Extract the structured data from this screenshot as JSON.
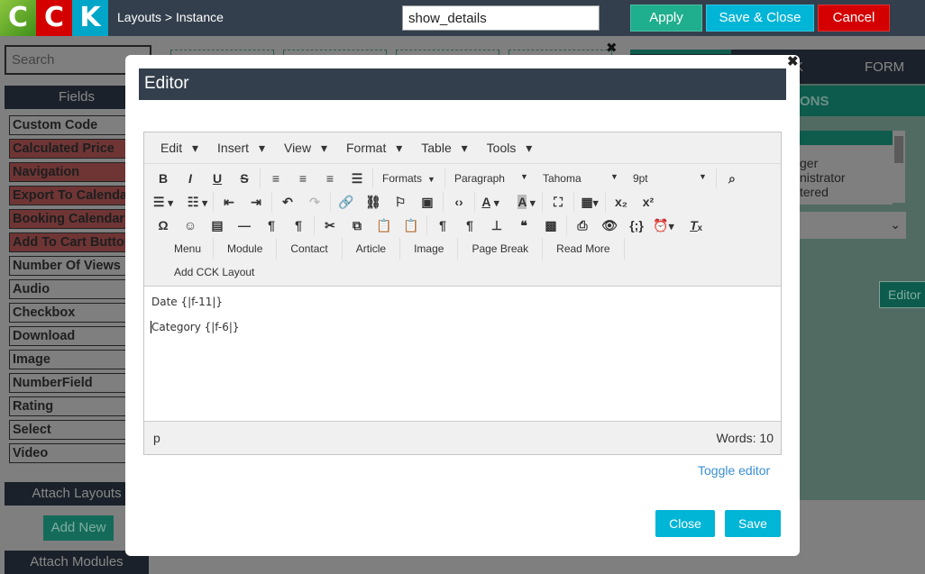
{
  "header": {
    "logo": [
      "C",
      "C",
      "K"
    ],
    "breadcrumb": "Layouts > Instance",
    "name_value": "show_details",
    "apply": "Apply",
    "save_close": "Save & Close",
    "cancel": "Cancel"
  },
  "sidebar": {
    "search_placeholder": "Search",
    "fields_title": "Fields",
    "fields": [
      {
        "label": "Custom Code",
        "red": false
      },
      {
        "label": "Calculated Price",
        "red": true
      },
      {
        "label": "Navigation",
        "red": true
      },
      {
        "label": "Export To Calendar",
        "red": true
      },
      {
        "label": "Booking Calendar",
        "red": true
      },
      {
        "label": "Add To Cart Button",
        "red": true
      },
      {
        "label": "Number Of Views",
        "red": false
      },
      {
        "label": "Audio",
        "red": false
      },
      {
        "label": "Checkbox",
        "red": false
      },
      {
        "label": "Download",
        "red": false
      },
      {
        "label": "Image",
        "red": false
      },
      {
        "label": "NumberField",
        "red": false
      },
      {
        "label": "Rating",
        "red": false
      },
      {
        "label": "Select",
        "red": false
      },
      {
        "label": "Video",
        "red": false
      }
    ],
    "attach_layouts": "Attach Layouts",
    "add_new": "Add New",
    "attach_modules": "Attach Modules"
  },
  "right_panel": {
    "tab_partial": "K",
    "tab_form": "FORM",
    "section_partial": "ONS",
    "list_items": [
      "ger",
      "nistrator",
      "tered"
    ],
    "editor_button": "Editor"
  },
  "modal": {
    "title": "Editor",
    "menu": [
      "Edit",
      "Insert",
      "View",
      "Format",
      "Table",
      "Tools"
    ],
    "formats": "Formats",
    "block": "Paragraph",
    "font": "Tahoma",
    "size": "9pt",
    "buttons": [
      "Menu",
      "Module",
      "Contact",
      "Article",
      "Image",
      "Page Break",
      "Read More",
      "Add CCK Layout"
    ],
    "content": [
      "Date {|f-11|}",
      "Category {|f-6|}"
    ],
    "path": "p",
    "words": "Words: 10",
    "toggle": "Toggle editor",
    "close": "Close",
    "save": "Save"
  }
}
